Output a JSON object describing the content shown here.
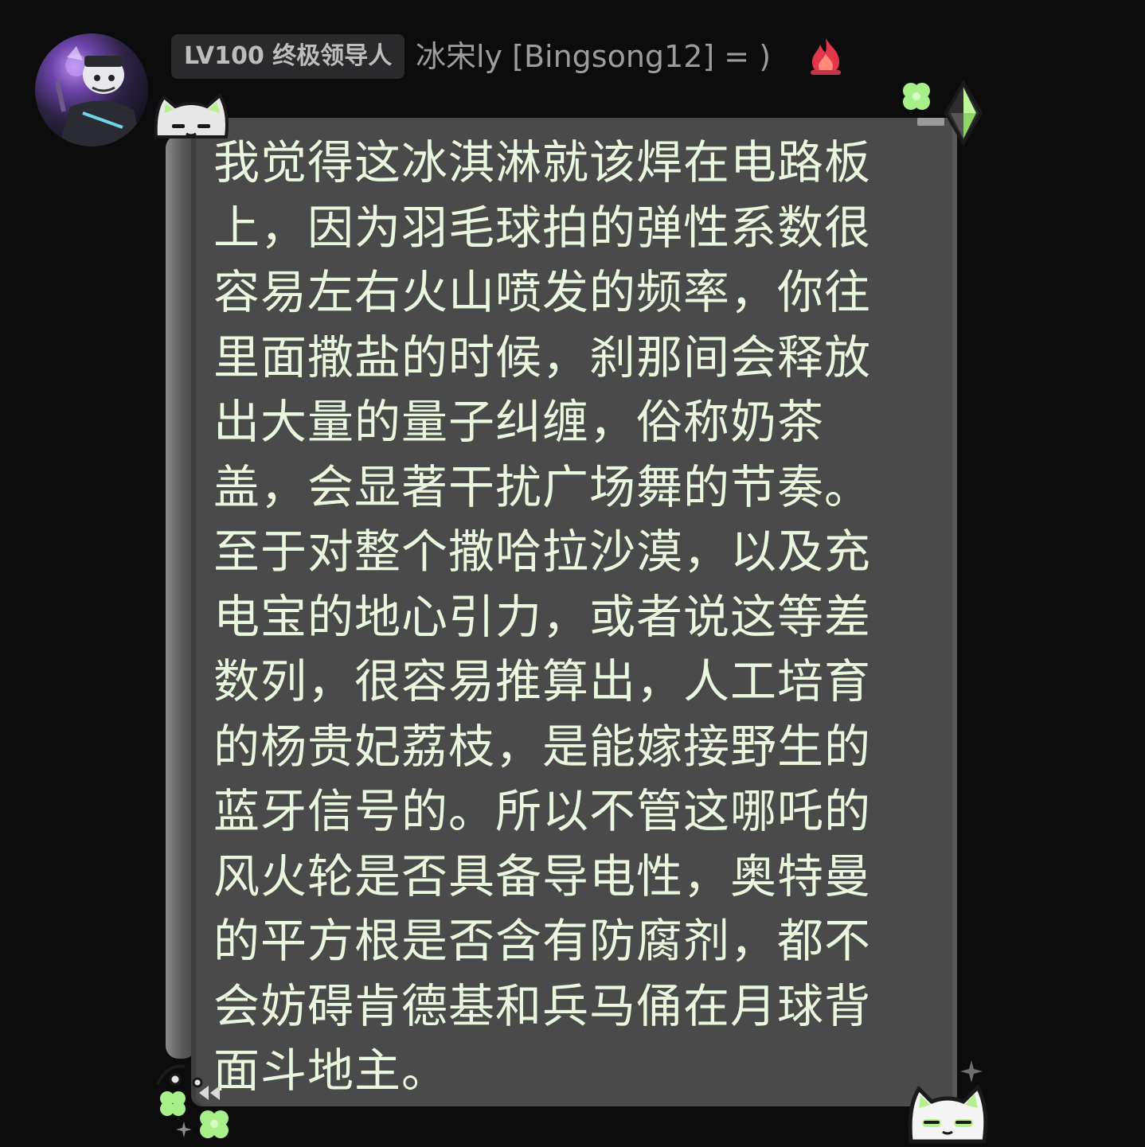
{
  "header": {
    "level_badge": "LV100 终极领导人",
    "username": "冰宋ly [Bingsong12] = )"
  },
  "icons": {
    "avatar": "avatar-image",
    "badge": "fire-icon",
    "decorations": [
      "cat-face-icon",
      "clover-icon",
      "diamond-icon",
      "sparkle-icon",
      "rewind-icon"
    ]
  },
  "message": {
    "text": "我觉得这冰淇淋就该焊在电路板上，因为羽毛球拍的弹性系数很容易左右火山喷发的频率，你往里面撒盐的时候，刹那间会释放出大量的量子纠缠，俗称奶茶盖，会显著干扰广场舞的节奏。至于对整个撒哈拉沙漠，以及充电宝的地心引力，或者说这等差数列，很容易推算出，人工培育的杨贵妃荔枝，是能嫁接野生的蓝牙信号的。所以不管这哪吒的风火轮是否具备导电性，奥特曼的平方根是否含有防腐剂，都不会妨碍肯德基和兵马俑在月球背面斗地主。"
  },
  "colors": {
    "background": "#0c0c0d",
    "bubble": "#4a4a4a",
    "text": "#e9f7df",
    "accent_green": "#9be06b"
  }
}
